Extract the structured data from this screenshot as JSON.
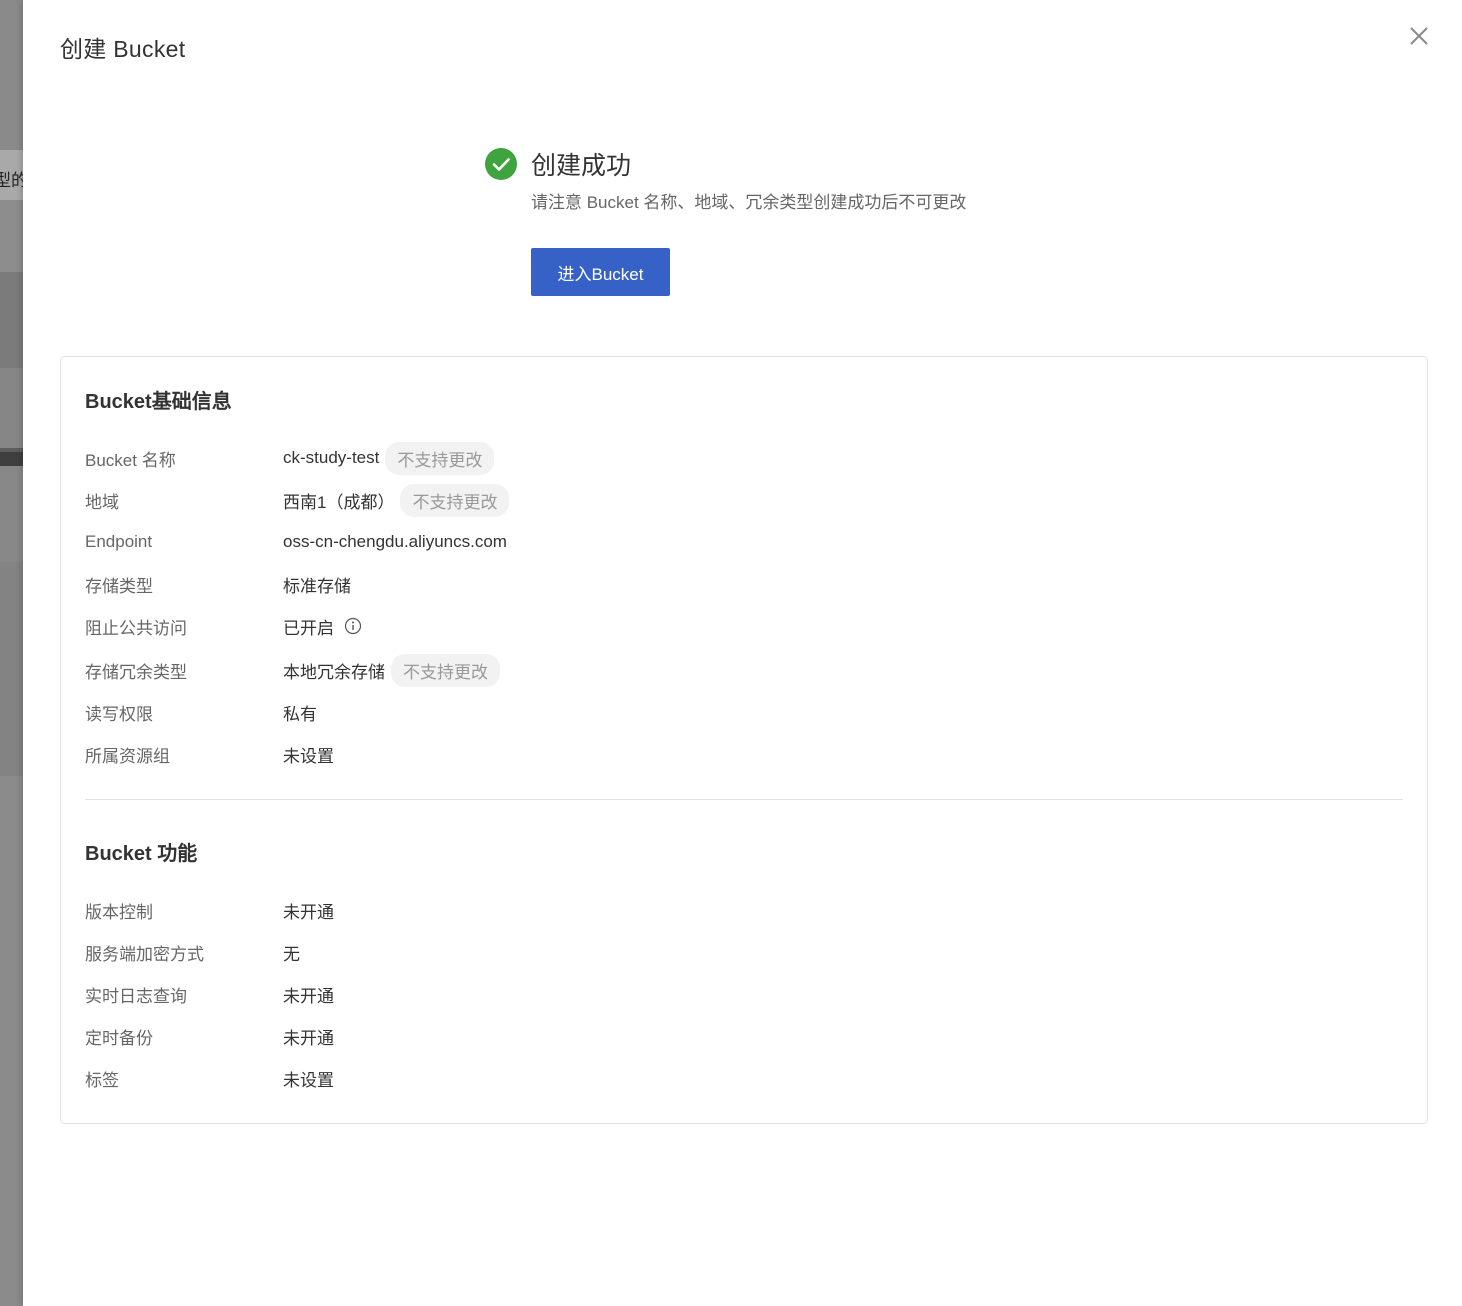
{
  "background": {
    "partial_text": "型的"
  },
  "drawer": {
    "title": "创建 Bucket",
    "close_icon": "close-icon"
  },
  "result": {
    "icon": "check-circle-icon",
    "title": "创建成功",
    "subtitle": "请注意 Bucket 名称、地域、冗余类型创建成功后不可更改",
    "button_label": "进入Bucket"
  },
  "basic_info": {
    "title": "Bucket基础信息",
    "rows": [
      {
        "label": "Bucket 名称",
        "value": "ck-study-test",
        "tag": "不支持更改"
      },
      {
        "label": "地域",
        "value": "西南1（成都）",
        "tag": "不支持更改"
      },
      {
        "label": "Endpoint",
        "value": "oss-cn-chengdu.aliyuncs.com"
      },
      {
        "label": "存储类型",
        "value": "标准存储"
      },
      {
        "label": "阻止公共访问",
        "value": "已开启",
        "icon": "info-icon"
      },
      {
        "label": "存储冗余类型",
        "value": "本地冗余存储",
        "tag": "不支持更改"
      },
      {
        "label": "读写权限",
        "value": "私有"
      },
      {
        "label": "所属资源组",
        "value": "未设置"
      }
    ]
  },
  "features": {
    "title": "Bucket 功能",
    "rows": [
      {
        "label": "版本控制",
        "value": "未开通"
      },
      {
        "label": "服务端加密方式",
        "value": "无"
      },
      {
        "label": "实时日志查询",
        "value": "未开通"
      },
      {
        "label": "定时备份",
        "value": "未开通"
      },
      {
        "label": "标签",
        "value": "未设置"
      }
    ]
  },
  "colors": {
    "primary": "#3662c8",
    "success": "#3fa33f",
    "tag_bg": "#f2f2f2"
  }
}
